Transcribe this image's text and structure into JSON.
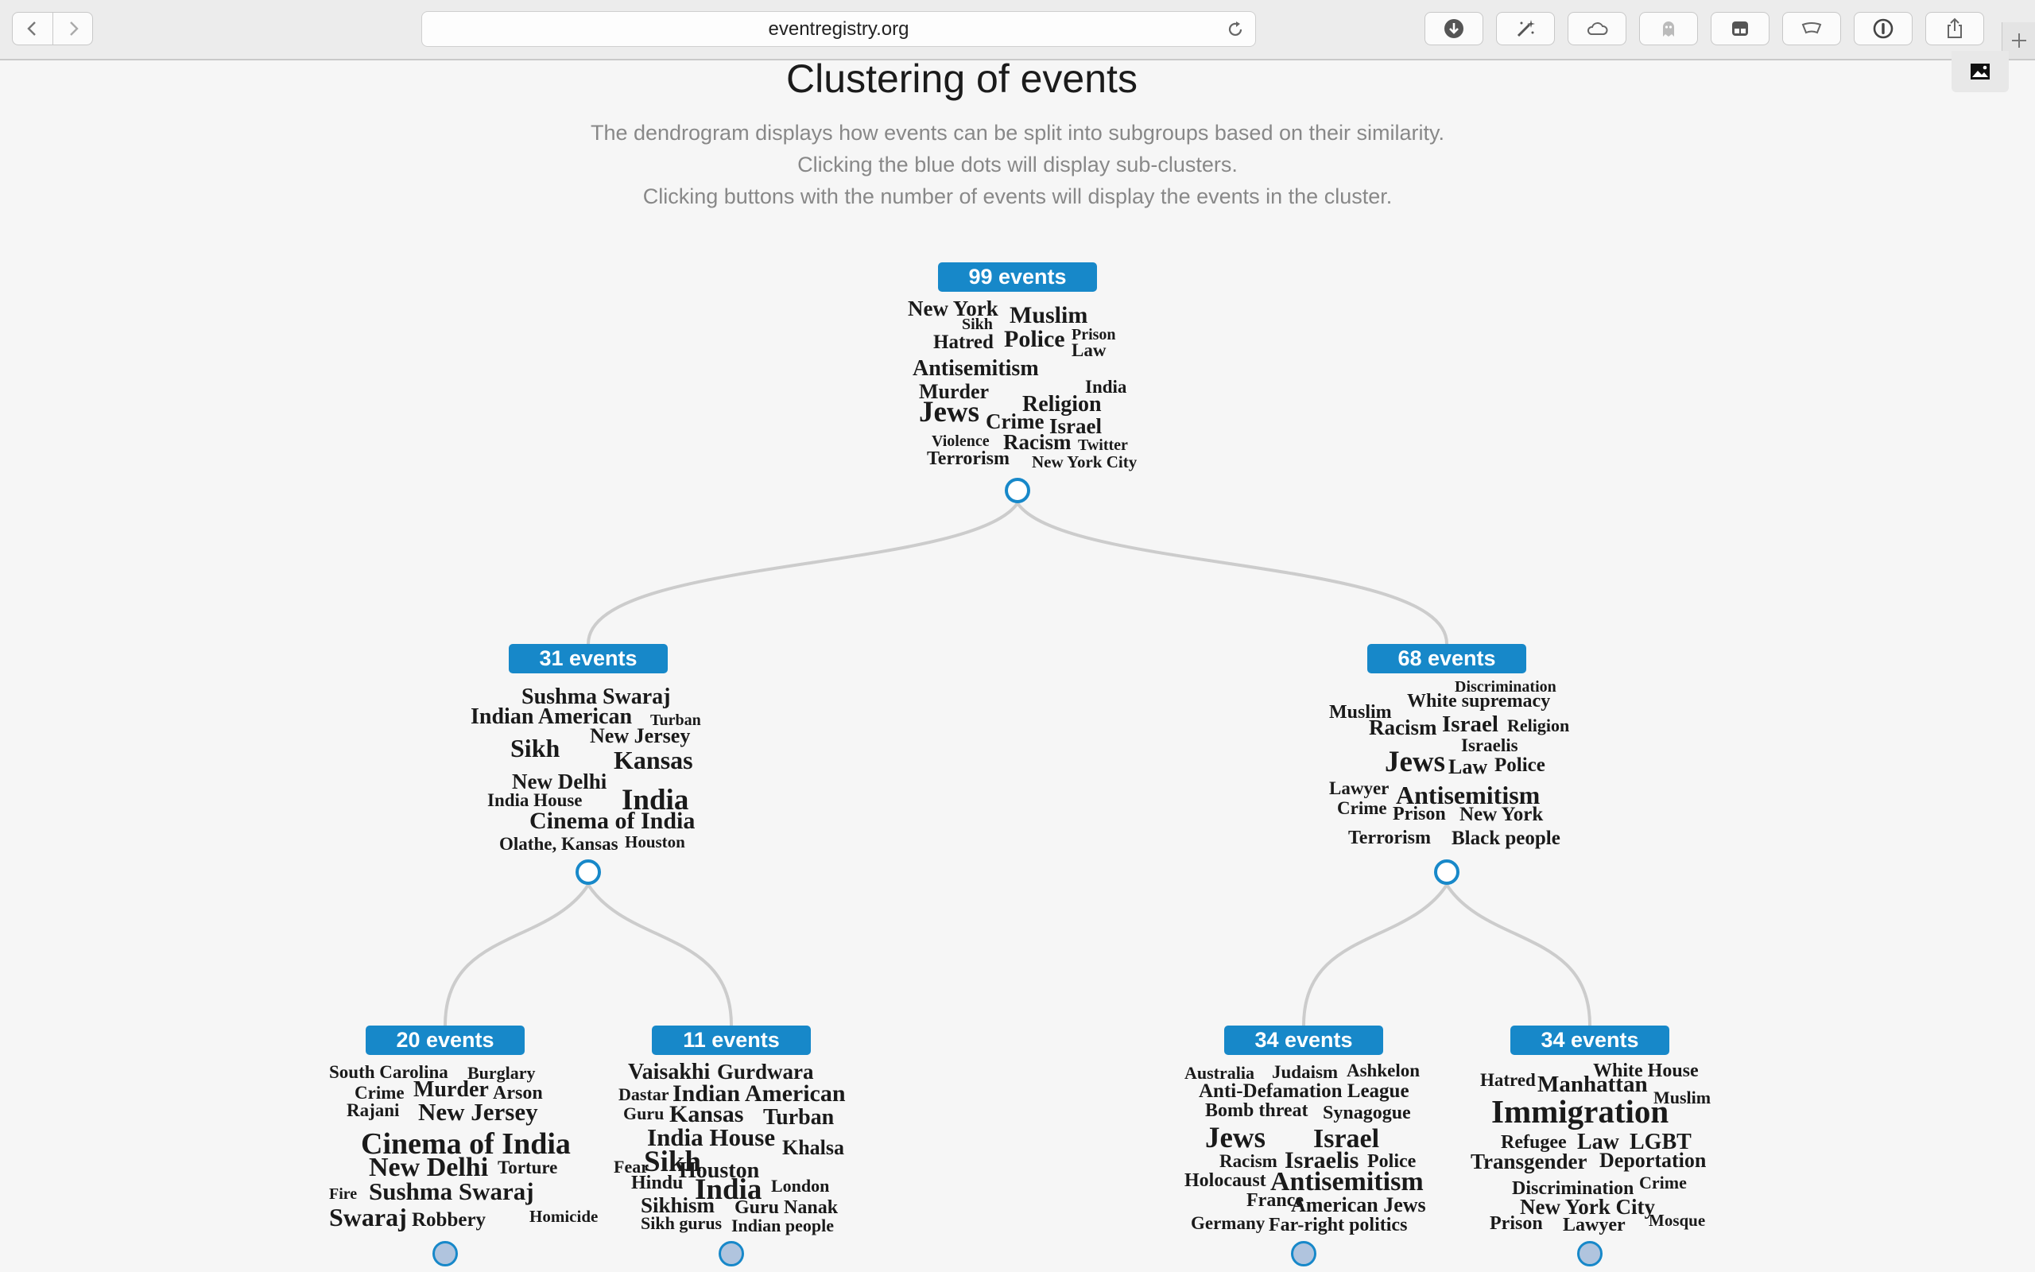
{
  "browser": {
    "url": "eventregistry.org",
    "toolbar_icons": [
      "download-icon",
      "magic-wand-icon",
      "cloud-icon",
      "ghost-icon",
      "tabs-icon",
      "reading-list-icon",
      "password-icon",
      "share-icon"
    ]
  },
  "page": {
    "title": "Clustering of events",
    "description": [
      "The dendrogram displays how events can be split into subgroups based on their similarity.",
      "Clicking the blue dots will display sub-clusters.",
      "Clicking buttons with the number of events will display the events in the cluster."
    ]
  },
  "colors": {
    "accent": "#1788c9",
    "leaf_fill": "#b0c4de",
    "link": "#cccccc"
  },
  "clusters": [
    {
      "id": "c99",
      "label": "99 events",
      "count": 99,
      "expanded": true,
      "words": [
        {
          "t": "New York"
        },
        {
          "t": "Sikh"
        },
        {
          "t": "Muslim"
        },
        {
          "t": "Hatred"
        },
        {
          "t": "Police"
        },
        {
          "t": "Prison"
        },
        {
          "t": "Law"
        },
        {
          "t": "Antisemitism"
        },
        {
          "t": "Murder"
        },
        {
          "t": "India"
        },
        {
          "t": "Religion"
        },
        {
          "t": "Jews"
        },
        {
          "t": "Crime"
        },
        {
          "t": "Israel"
        },
        {
          "t": "Violence"
        },
        {
          "t": "Racism"
        },
        {
          "t": "Twitter"
        },
        {
          "t": "Terrorism"
        },
        {
          "t": "New York City"
        }
      ]
    },
    {
      "id": "c31",
      "label": "31 events",
      "count": 31,
      "expanded": true,
      "words": [
        {
          "t": "Sushma Swaraj"
        },
        {
          "t": "Indian American"
        },
        {
          "t": "Turban"
        },
        {
          "t": "New Jersey"
        },
        {
          "t": "Sikh"
        },
        {
          "t": "Kansas"
        },
        {
          "t": "New Delhi"
        },
        {
          "t": "India House"
        },
        {
          "t": "India"
        },
        {
          "t": "Cinema of India"
        },
        {
          "t": "Olathe, Kansas"
        },
        {
          "t": "Houston"
        }
      ]
    },
    {
      "id": "c68",
      "label": "68 events",
      "count": 68,
      "expanded": true,
      "words": [
        {
          "t": "Discrimination"
        },
        {
          "t": "White supremacy"
        },
        {
          "t": "Muslim"
        },
        {
          "t": "Racism"
        },
        {
          "t": "Israel"
        },
        {
          "t": "Religion"
        },
        {
          "t": "Israelis"
        },
        {
          "t": "Jews"
        },
        {
          "t": "Law"
        },
        {
          "t": "Police"
        },
        {
          "t": "Lawyer"
        },
        {
          "t": "Antisemitism"
        },
        {
          "t": "Crime"
        },
        {
          "t": "Prison"
        },
        {
          "t": "New York"
        },
        {
          "t": "Terrorism"
        },
        {
          "t": "Black people"
        }
      ]
    },
    {
      "id": "c20",
      "label": "20 events",
      "count": 20,
      "expanded": false,
      "words": [
        {
          "t": "South Carolina"
        },
        {
          "t": "Burglary"
        },
        {
          "t": "Crime"
        },
        {
          "t": "Murder"
        },
        {
          "t": "Arson"
        },
        {
          "t": "Rajani"
        },
        {
          "t": "New Jersey"
        },
        {
          "t": "Cinema of India"
        },
        {
          "t": "New Delhi"
        },
        {
          "t": "Torture"
        },
        {
          "t": "Fire"
        },
        {
          "t": "Sushma Swaraj"
        },
        {
          "t": "Swaraj"
        },
        {
          "t": "Robbery"
        },
        {
          "t": "Homicide"
        }
      ]
    },
    {
      "id": "c11",
      "label": "11 events",
      "count": 11,
      "expanded": false,
      "words": [
        {
          "t": "Vaisakhi"
        },
        {
          "t": "Gurdwara"
        },
        {
          "t": "Dastar"
        },
        {
          "t": "Indian American"
        },
        {
          "t": "Guru"
        },
        {
          "t": "Kansas"
        },
        {
          "t": "Turban"
        },
        {
          "t": "India House"
        },
        {
          "t": "Khalsa"
        },
        {
          "t": "Fear"
        },
        {
          "t": "Sikh"
        },
        {
          "t": "Houston"
        },
        {
          "t": "Hindu"
        },
        {
          "t": "India"
        },
        {
          "t": "London"
        },
        {
          "t": "Sikhism"
        },
        {
          "t": "Guru Nanak"
        },
        {
          "t": "Sikh gurus"
        },
        {
          "t": "Indian people"
        }
      ]
    },
    {
      "id": "c34a",
      "label": "34 events",
      "count": 34,
      "expanded": false,
      "words": [
        {
          "t": "Australia"
        },
        {
          "t": "Judaism"
        },
        {
          "t": "Ashkelon"
        },
        {
          "t": "Anti-Defamation League"
        },
        {
          "t": "Bomb threat"
        },
        {
          "t": "Synagogue"
        },
        {
          "t": "Jews"
        },
        {
          "t": "Israel"
        },
        {
          "t": "Racism"
        },
        {
          "t": "Israelis"
        },
        {
          "t": "Police"
        },
        {
          "t": "Holocaust"
        },
        {
          "t": "Antisemitism"
        },
        {
          "t": "France"
        },
        {
          "t": "American Jews"
        },
        {
          "t": "Germany"
        },
        {
          "t": "Far-right politics"
        }
      ]
    },
    {
      "id": "c34b",
      "label": "34 events",
      "count": 34,
      "expanded": false,
      "words": [
        {
          "t": "White House"
        },
        {
          "t": "Hatred"
        },
        {
          "t": "Manhattan"
        },
        {
          "t": "Muslim"
        },
        {
          "t": "Immigration"
        },
        {
          "t": "Refugee"
        },
        {
          "t": "Law"
        },
        {
          "t": "LGBT"
        },
        {
          "t": "Transgender"
        },
        {
          "t": "Deportation"
        },
        {
          "t": "Crime"
        },
        {
          "t": "Discrimination"
        },
        {
          "t": "New York City"
        },
        {
          "t": "Prison"
        },
        {
          "t": "Lawyer"
        },
        {
          "t": "Mosque"
        }
      ]
    }
  ]
}
